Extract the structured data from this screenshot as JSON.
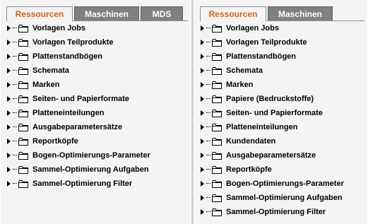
{
  "left_panel": {
    "tabs": [
      {
        "label": "Ressourcen",
        "active": true
      },
      {
        "label": "Maschinen",
        "active": false
      },
      {
        "label": "MDS",
        "active": false
      }
    ],
    "items": [
      "Vorlagen Jobs",
      "Vorlagen Teilprodukte",
      "Plattenstandbögen",
      "Schemata",
      "Marken",
      "Seiten- und Papierformate",
      "Platteneinteilungen",
      "Ausgabeparametersätze",
      "Reportköpfe",
      "Bogen-Optimierungs-Parameter",
      "Sammel-Optimierung Aufgaben",
      "Sammel-Optimierung Filter"
    ]
  },
  "right_panel": {
    "tabs": [
      {
        "label": "Ressourcen",
        "active": true
      },
      {
        "label": "Maschinen",
        "active": false
      }
    ],
    "items": [
      "Vorlagen Jobs",
      "Vorlagen Teilprodukte",
      "Plattenstandbögen",
      "Schemata",
      "Marken",
      "Papiere (Bedruckstoffe)",
      "Seiten- und Papierformate",
      "Platteneinteilungen",
      "Kundendaten",
      "Ausgabeparametersätze",
      "Reportköpfe",
      "Bogen-Optimierungs-Parameter",
      "Sammel-Optimierung Aufgaben",
      "Sammel-Optimierung Filter"
    ]
  },
  "colors": {
    "active_tab_text": "#e0601c",
    "inactive_tab_bg": "#808080"
  },
  "icons": {
    "expander": "triangle-right-icon",
    "folder": "folder-icon"
  }
}
